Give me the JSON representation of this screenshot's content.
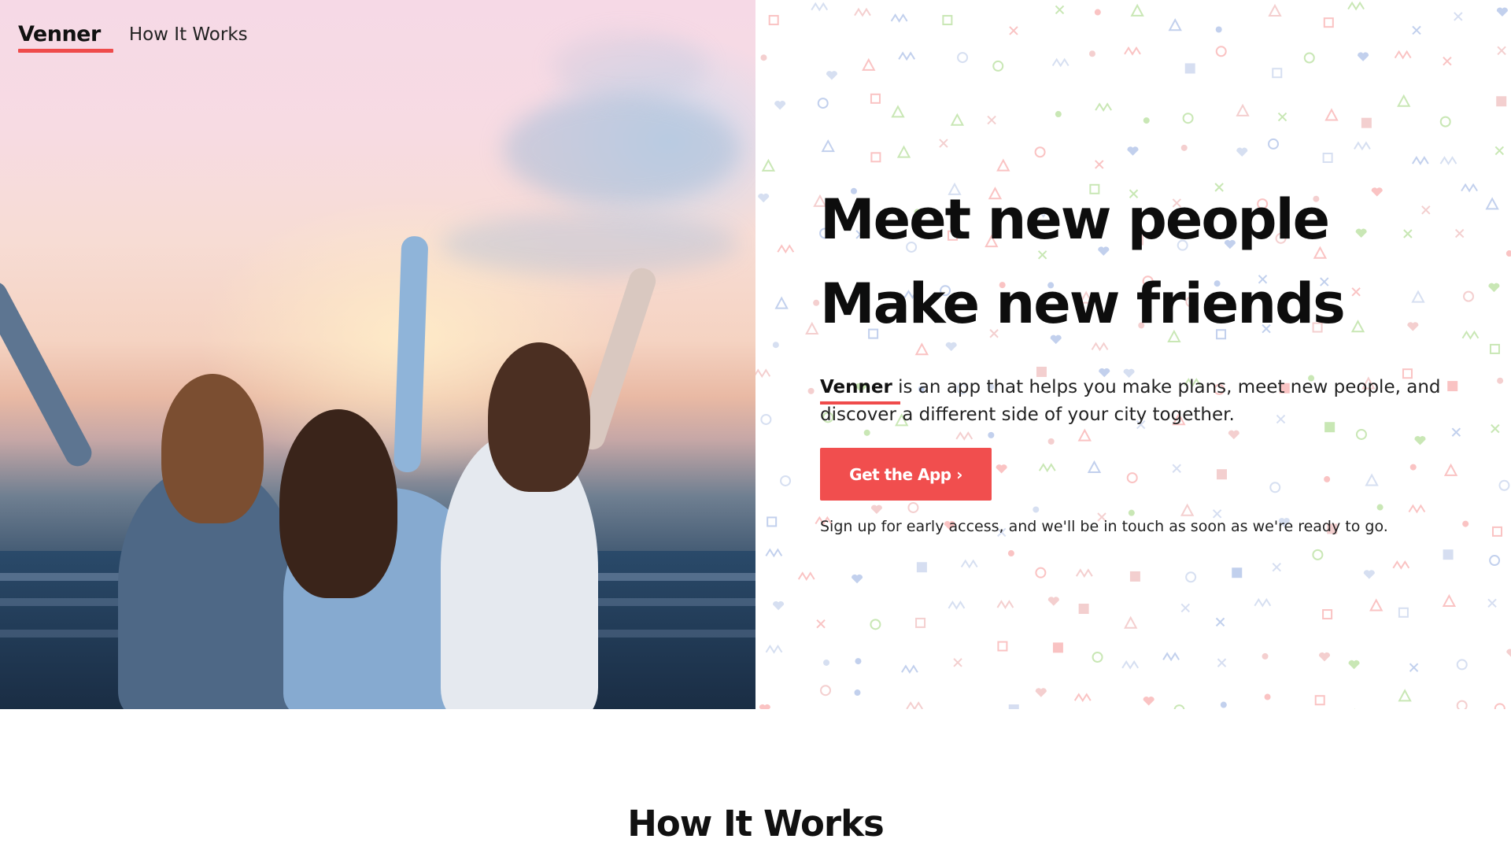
{
  "nav": {
    "brand": "Venner",
    "links": [
      "How It Works"
    ]
  },
  "hero": {
    "headline_line1": "Meet new people",
    "headline_line2": "Make new friends",
    "description_brand": "Venner",
    "description_line1_rest": " is an app that helps you make plans, meet new people, and",
    "description_line2": "discover a different side of your city together.",
    "cta_label": "Get the App ›",
    "note": "Sign up for early access, and we'll be in touch as soon as we're ready to go."
  },
  "section": {
    "title": "How It Works"
  },
  "colors": {
    "accent": "#ef4b4b",
    "text": "#111111",
    "pattern_pink": "#f9b9b9",
    "pattern_blue": "#b7c8ea",
    "pattern_green": "#bfe3a8"
  },
  "images": {
    "hero_photo": "three friends raising their arms on a rooftop at sunset"
  }
}
